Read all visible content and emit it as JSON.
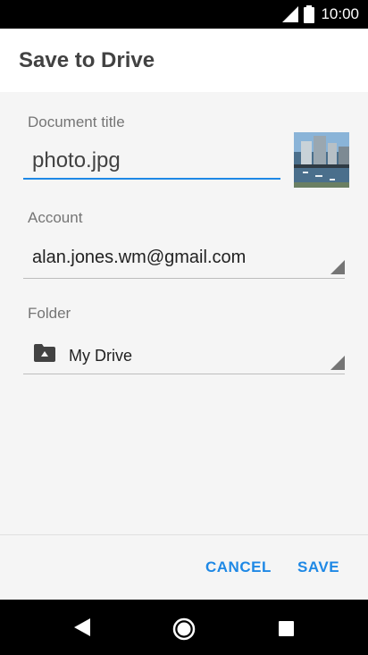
{
  "status_bar": {
    "time": "10:00",
    "icons": [
      "signal-icon",
      "battery-icon"
    ]
  },
  "dialog": {
    "title": "Save to Drive",
    "document_title": {
      "label": "Document title",
      "value": "photo.jpg"
    },
    "account": {
      "label": "Account",
      "value": "alan.jones.wm@gmail.com"
    },
    "folder": {
      "label": "Folder",
      "value": "My Drive",
      "icon": "drive-folder-icon"
    },
    "actions": {
      "cancel": "CANCEL",
      "save": "SAVE"
    }
  },
  "colors": {
    "accent": "#1e88e5",
    "title_text": "#424242",
    "label_text": "#757575",
    "background": "#f5f5f5"
  },
  "nav_bar": {
    "icons": [
      "back-icon",
      "home-icon",
      "recents-icon"
    ]
  }
}
